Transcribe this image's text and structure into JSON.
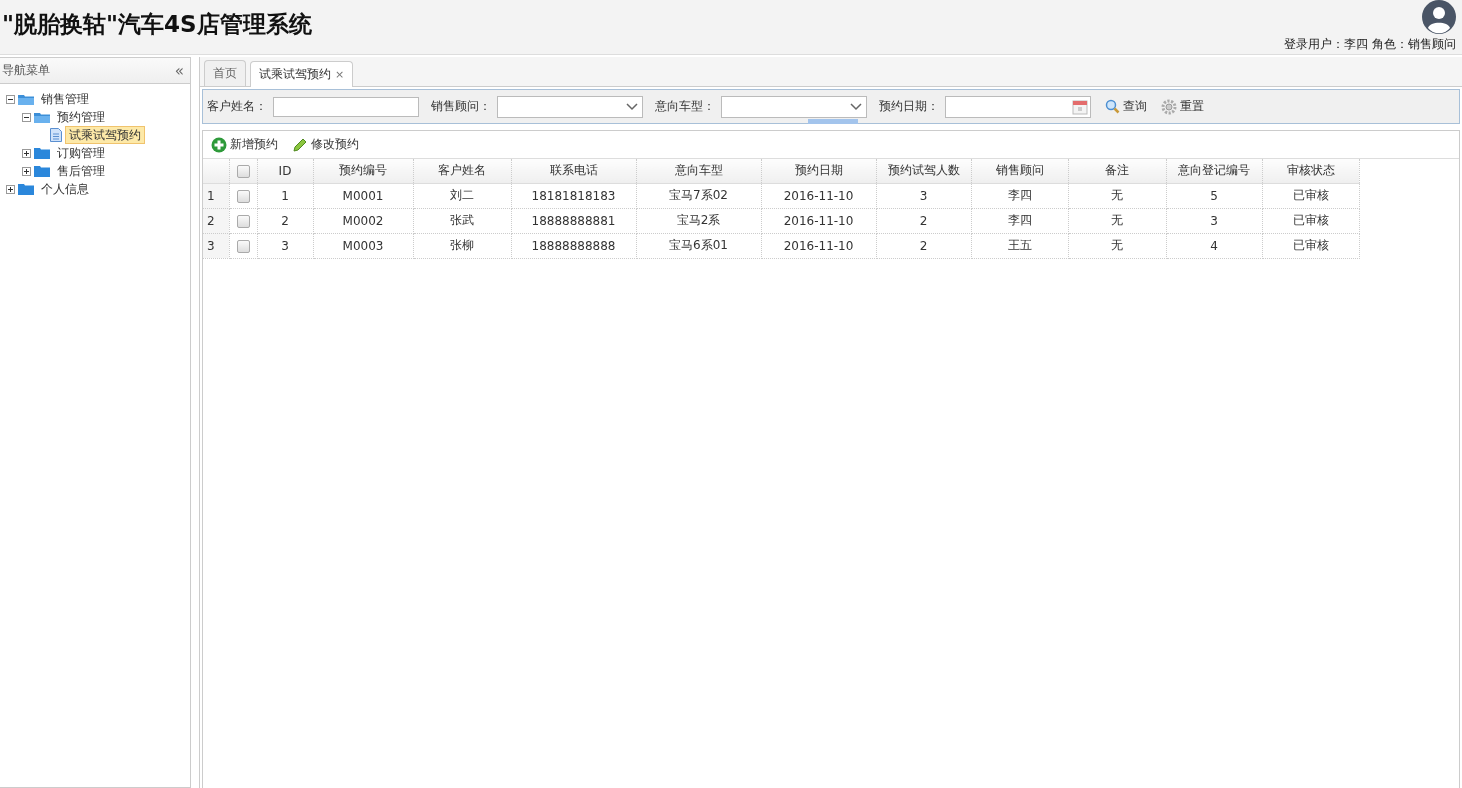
{
  "header": {
    "title": "\"脱胎换轱\"汽车4S店管理系统",
    "user_label": "登录用户：",
    "user": "李四",
    "role_label": "角色：",
    "role": "销售顾问"
  },
  "sidebar": {
    "title": "导航菜单",
    "collapse": "«",
    "tree": [
      {
        "kind": "folder",
        "label": "销售管理",
        "expanded": true,
        "selected": false,
        "children": [
          {
            "kind": "folder",
            "label": "预约管理",
            "expanded": true,
            "selected": false,
            "children": [
              {
                "kind": "file",
                "label": "试乘试驾预约",
                "selected": true
              }
            ]
          },
          {
            "kind": "folder",
            "label": "订购管理",
            "expanded": false,
            "selected": false
          },
          {
            "kind": "folder",
            "label": "售后管理",
            "expanded": false,
            "selected": false
          }
        ]
      },
      {
        "kind": "folder",
        "label": "个人信息",
        "expanded": false,
        "selected": false
      }
    ]
  },
  "tabs": [
    {
      "label": "首页",
      "selected": false
    },
    {
      "label": "试乘试驾预约",
      "selected": true,
      "close": "×"
    }
  ],
  "filters": [
    {
      "kind": "text",
      "label": "客户姓名："
    },
    {
      "kind": "select",
      "label": "销售顾问："
    },
    {
      "kind": "select",
      "label": "意向车型："
    },
    {
      "kind": "date",
      "label": "预约日期："
    }
  ],
  "filter_buttons": [
    {
      "kind": "search",
      "label": "查询"
    },
    {
      "kind": "reset",
      "label": "重置"
    }
  ],
  "toolbar": [
    {
      "kind": "add",
      "label": "新增预约"
    },
    {
      "kind": "edit",
      "label": "修改预约"
    }
  ],
  "table": {
    "header_checked": false,
    "columns": [
      "ID",
      "预约编号",
      "客户姓名",
      "联系电话",
      "意向车型",
      "预约日期",
      "预约试驾人数",
      "销售顾问",
      "备注",
      "意向登记编号",
      "审核状态"
    ],
    "rows": [
      {
        "number": "1",
        "checked": false,
        "cells": [
          "1",
          "M0001",
          "刘二",
          "18181818183",
          "宝马7系02",
          "2016-11-10",
          "3",
          "李四",
          "无",
          "5",
          "已审核"
        ]
      },
      {
        "number": "2",
        "checked": false,
        "cells": [
          "2",
          "M0002",
          "张武",
          "18888888881",
          "宝马2系",
          "2016-11-10",
          "2",
          "李四",
          "无",
          "3",
          "已审核"
        ]
      },
      {
        "number": "3",
        "checked": false,
        "cells": [
          "3",
          "M0003",
          "张柳",
          "18888888888",
          "宝马6系01",
          "2016-11-10",
          "2",
          "王五",
          "无",
          "4",
          "已审核"
        ]
      }
    ]
  }
}
